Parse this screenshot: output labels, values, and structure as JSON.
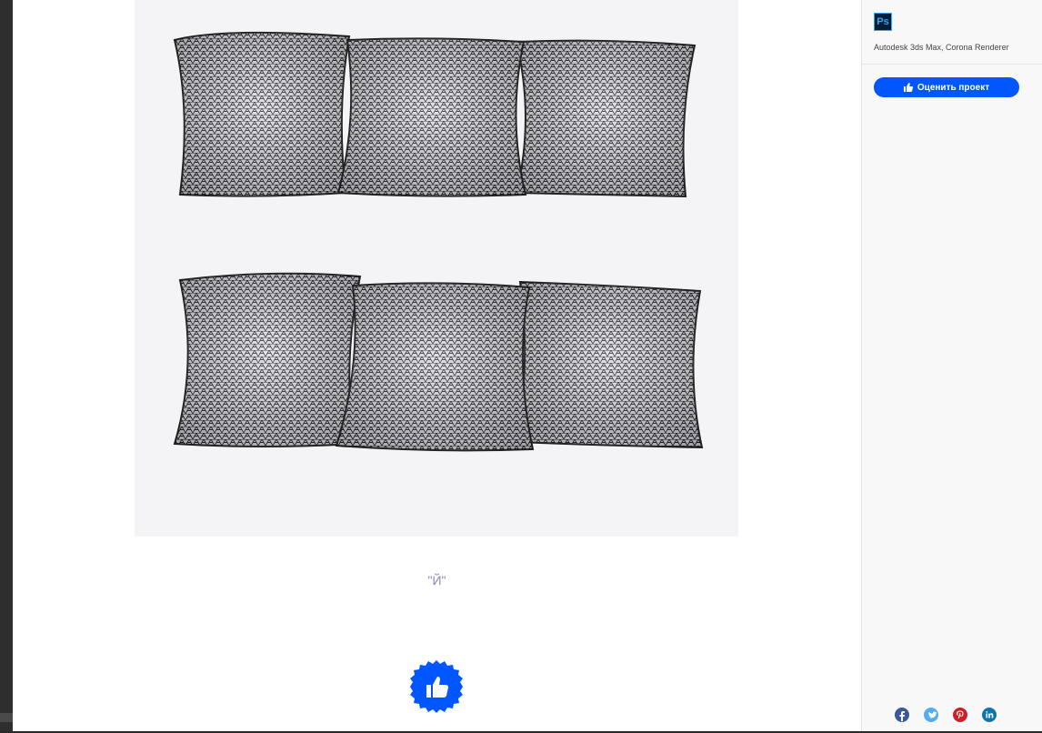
{
  "artwork": {
    "caption": "\"Й\""
  },
  "appreciate": {
    "icon": "thumbs-up-icon"
  },
  "sidebar": {
    "tools_icon": "photoshop-icon",
    "tools_icon_label": "Ps",
    "tools_text": "Autodesk 3ds Max, Corona Renderer",
    "rate_button_label": "Оценить проект",
    "share_icons": [
      "facebook-icon",
      "twitter-icon",
      "pinterest-icon",
      "linkedin-icon"
    ]
  },
  "colors": {
    "accent": "#0057ff",
    "pillow": "#d8d6d8",
    "pattern": "#1a1a2a"
  }
}
